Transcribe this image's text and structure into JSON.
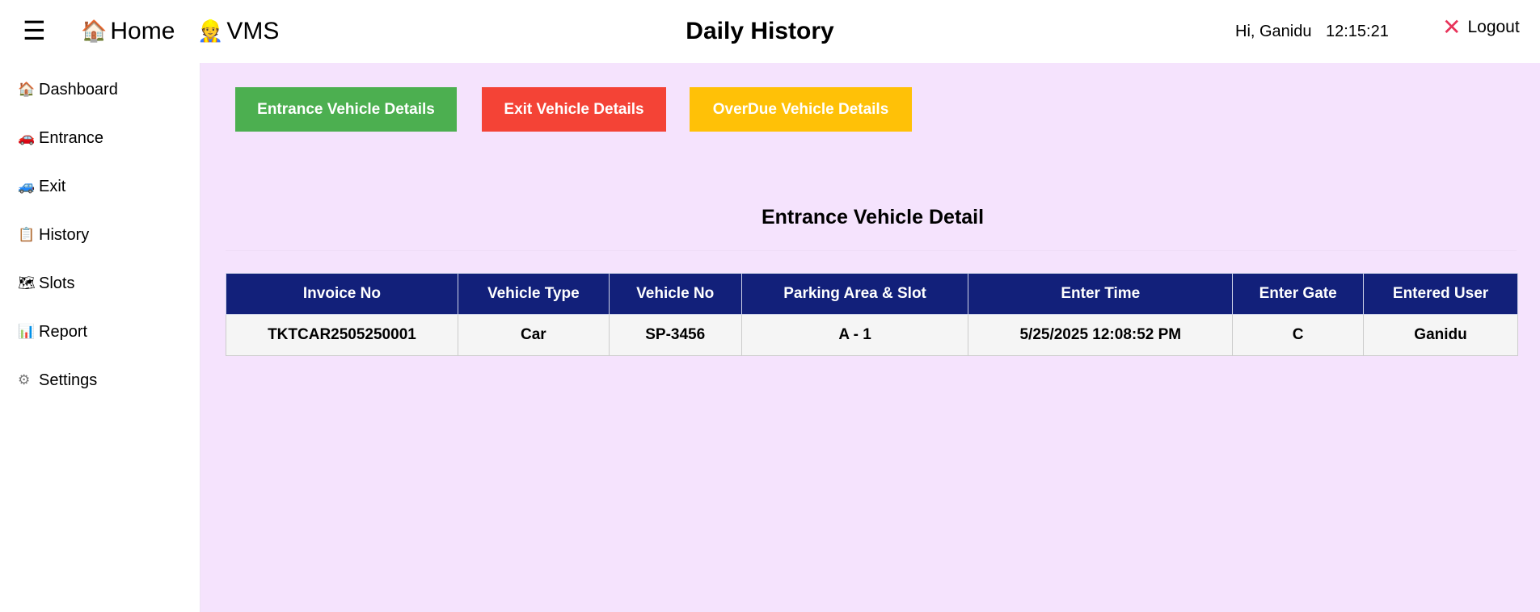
{
  "header": {
    "menu_icon": "hamburger-icon",
    "home_icon": "house-icon",
    "home_label": "Home",
    "vms_icon": "worker-icon",
    "vms_label": "VMS",
    "title": "Daily History",
    "greeting": "Hi, Ganidu",
    "clock": "12:15:21",
    "logout_icon": "close-x-icon",
    "logout_label": "Logout"
  },
  "sidebar": {
    "items": [
      {
        "label": "Dashboard",
        "icon": "house-icon"
      },
      {
        "label": "Entrance",
        "icon": "red-car-icon"
      },
      {
        "label": "Exit",
        "icon": "blue-car-icon"
      },
      {
        "label": "History",
        "icon": "clipboard-icon"
      },
      {
        "label": "Slots",
        "icon": "map-icon"
      },
      {
        "label": "Report",
        "icon": "bar-chart-icon"
      },
      {
        "label": "Settings",
        "icon": "gear-icon"
      }
    ]
  },
  "buttons": {
    "entrance": "Entrance Vehicle Details",
    "exit": "Exit Vehicle Details",
    "overdue": "OverDue Vehicle Details"
  },
  "section_title": "Entrance Vehicle Detail",
  "table": {
    "columns": [
      "Invoice No",
      "Vehicle Type",
      "Vehicle No",
      "Parking Area & Slot",
      "Enter Time",
      "Enter Gate",
      "Entered User"
    ],
    "rows": [
      [
        "TKTCAR2505250001",
        "Car",
        "SP-3456",
        "A - 1",
        "5/25/2025 12:08:52 PM",
        "C",
        "Ganidu"
      ]
    ]
  },
  "colors": {
    "content_bg": "#f5e3fd",
    "table_header_bg": "#12207a",
    "entrance_button": "#4caf50",
    "exit_button": "#f44336",
    "overdue_button": "#ffc107",
    "logout_icon": "#e8335a"
  }
}
